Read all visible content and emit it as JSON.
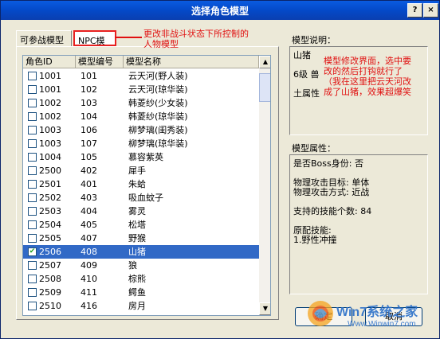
{
  "window": {
    "title": "选择角色模型",
    "help_label": "?",
    "close_label": "×"
  },
  "tabs": [
    {
      "label": "可参战模型"
    },
    {
      "label": "NPC模型"
    }
  ],
  "list": {
    "headers": [
      "角色ID",
      "模型编号",
      "模型名称"
    ],
    "rows": [
      {
        "checked": false,
        "id": "1001",
        "model": "101",
        "name": "云天河(野人装)"
      },
      {
        "checked": false,
        "id": "1001",
        "model": "102",
        "name": "云天河(琼华装)"
      },
      {
        "checked": false,
        "id": "1002",
        "model": "103",
        "name": "韩菱纱(少女装)"
      },
      {
        "checked": false,
        "id": "1002",
        "model": "104",
        "name": "韩菱纱(琼华装)"
      },
      {
        "checked": false,
        "id": "1003",
        "model": "106",
        "name": "柳梦璃(闺秀装)"
      },
      {
        "checked": false,
        "id": "1003",
        "model": "107",
        "name": "柳梦璃(琼华装)"
      },
      {
        "checked": false,
        "id": "1004",
        "model": "105",
        "name": "慕容紫英"
      },
      {
        "checked": false,
        "id": "2500",
        "model": "402",
        "name": "犀手"
      },
      {
        "checked": false,
        "id": "2501",
        "model": "401",
        "name": "朱蛤"
      },
      {
        "checked": false,
        "id": "2502",
        "model": "403",
        "name": "吸血蚊子"
      },
      {
        "checked": false,
        "id": "2503",
        "model": "404",
        "name": "雾灵"
      },
      {
        "checked": false,
        "id": "2504",
        "model": "405",
        "name": "松塔"
      },
      {
        "checked": false,
        "id": "2505",
        "model": "407",
        "name": "野猴"
      },
      {
        "checked": true,
        "id": "2506",
        "model": "408",
        "name": "山猪"
      },
      {
        "checked": false,
        "id": "2507",
        "model": "409",
        "name": "狼"
      },
      {
        "checked": false,
        "id": "2508",
        "model": "410",
        "name": "棕熊"
      },
      {
        "checked": false,
        "id": "2509",
        "model": "411",
        "name": "鳄鱼"
      },
      {
        "checked": false,
        "id": "2510",
        "model": "416",
        "name": "房月"
      }
    ],
    "selected_index": 13,
    "scroll_up": "▲",
    "scroll_down": "▼"
  },
  "annotations": {
    "top": [
      "更改非战斗状态下所控制的",
      "人物模型"
    ],
    "right": [
      "模型修改界面，选中要",
      "改的然后打钩就行了",
      "（我在这里把云天河改",
      "成了山猪，效果超爆笑"
    ]
  },
  "description": {
    "label": "模型说明：",
    "lines": [
      "山猪",
      "6级 兽",
      "土属性"
    ]
  },
  "attributes": {
    "label": "模型属性：",
    "lines": [
      "是否Boss身份: 否",
      "",
      "物理攻击目标: 单体",
      "物理攻击方式: 近战",
      "",
      "支持的技能个数: 84",
      "",
      "原配技能:",
      "1.野性冲撞"
    ]
  },
  "buttons": {
    "ok": "确定",
    "cancel": "取消"
  },
  "watermark": {
    "brand": "Win7系统之家",
    "url": "Www.Winwin7.com"
  },
  "colors": {
    "titlebar": "#0a5be0",
    "selection": "#3169c6",
    "annotation": "#e01010"
  }
}
